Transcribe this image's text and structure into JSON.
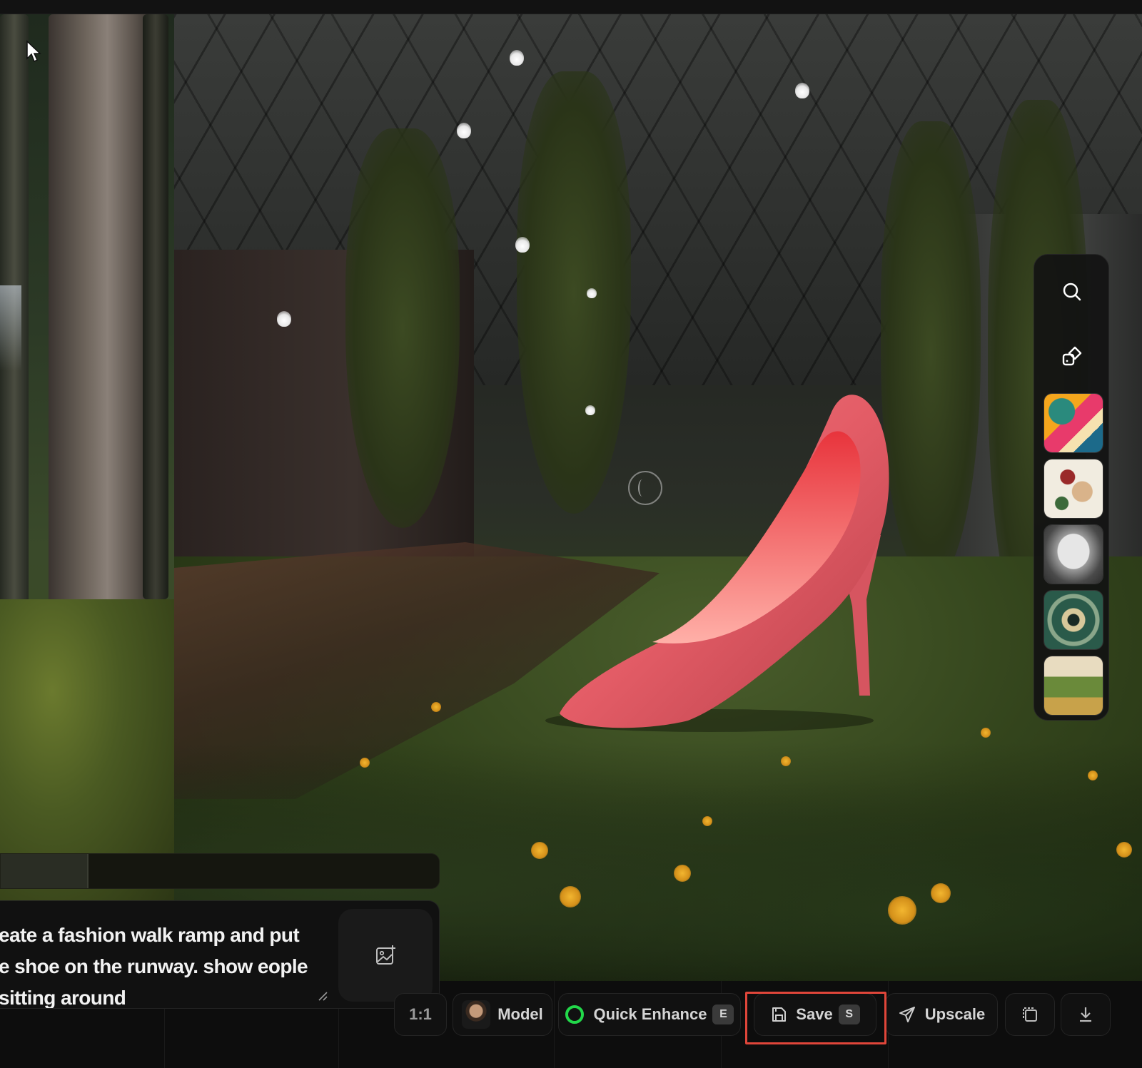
{
  "prompt": {
    "text": "eate a fashion walk ramp and put e shoe on the runway. show eople sitting around"
  },
  "progress": {
    "fraction": 0.2
  },
  "side_toolbar": {
    "tools": [
      {
        "icon": "search-icon"
      },
      {
        "icon": "shapes-icon"
      }
    ],
    "style_thumbnails": [
      {
        "name": "style-thumbnail-abstract",
        "colors": [
          "#f4a61d",
          "#e83a6b",
          "#2a8a7d",
          "#f6e2b0"
        ]
      },
      {
        "name": "style-thumbnail-floral",
        "colors": [
          "#f1ece0",
          "#9a2a2a",
          "#3c6a3a",
          "#d9b38a"
        ]
      },
      {
        "name": "style-thumbnail-sketch",
        "colors": [
          "#e6e6e6",
          "#4a4a4a",
          "#9a9a9a",
          "#2a2a2a"
        ]
      },
      {
        "name": "style-thumbnail-eye",
        "colors": [
          "#2a5a4a",
          "#d8c89a",
          "#1a2a24",
          "#8aa68a"
        ]
      },
      {
        "name": "style-thumbnail-landscape",
        "colors": [
          "#e8dcc0",
          "#6a8a3a",
          "#c8a24a",
          "#3a5a2a"
        ]
      }
    ]
  },
  "bottom_bar": {
    "aspect_label": "1:1",
    "model_label": "Model",
    "quick_enhance_label": "Quick Enhance",
    "quick_enhance_key": "E",
    "save_label": "Save",
    "save_key": "S",
    "upscale_label": "Upscale"
  },
  "colors": {
    "accent_green": "#22d84a",
    "highlight_red": "#e0463a",
    "shoe_pink": "#e8606a"
  }
}
